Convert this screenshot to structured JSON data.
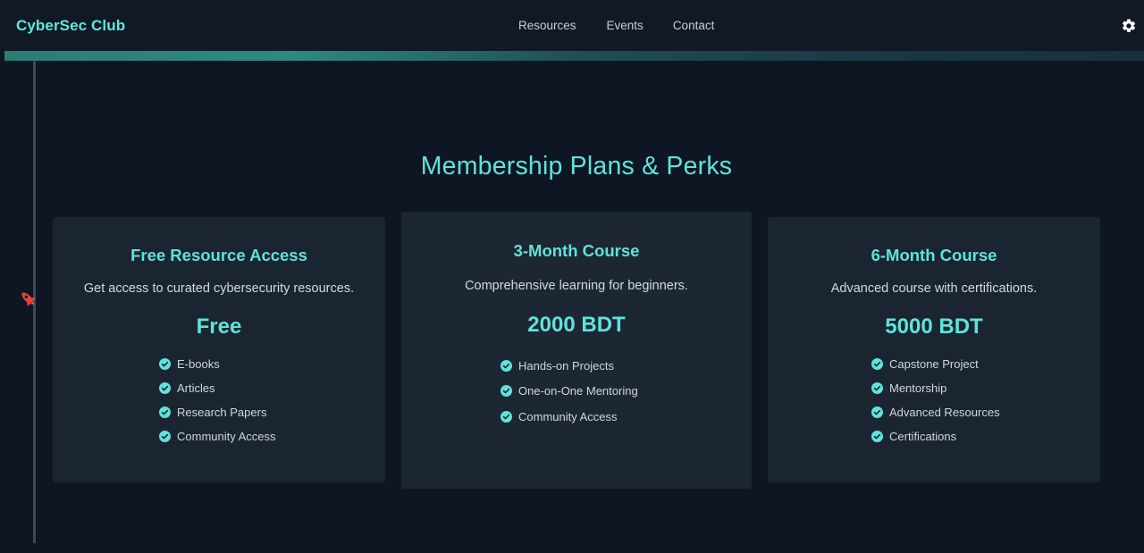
{
  "navbar": {
    "brand": "CyberSec Club",
    "links": [
      "Resources",
      "Events",
      "Contact"
    ],
    "settings_icon": "gear-icon"
  },
  "main": {
    "title": "Membership Plans & Perks",
    "plans": [
      {
        "title": "Free Resource Access",
        "description": "Get access to curated cybersecurity resources.",
        "price": "Free",
        "perks": [
          "E-books",
          "Articles",
          "Research Papers",
          "Community Access"
        ]
      },
      {
        "title": "3-Month Course",
        "description": "Comprehensive learning for beginners.",
        "price": "2000 BDT",
        "perks": [
          "Hands-on Projects",
          "One-on-One Mentoring",
          "Community Access"
        ]
      },
      {
        "title": "6-Month Course",
        "description": "Advanced course with certifications.",
        "price": "5000 BDT",
        "perks": [
          "Capstone Project",
          "Mentorship",
          "Advanced Resources",
          "Certifications"
        ]
      }
    ]
  },
  "colors": {
    "accent": "#5fe3da",
    "background": "#0e1624",
    "card": "#1b2531",
    "rocket": "#e8413a"
  },
  "timeline": {
    "marker_icon": "rocket-icon"
  }
}
